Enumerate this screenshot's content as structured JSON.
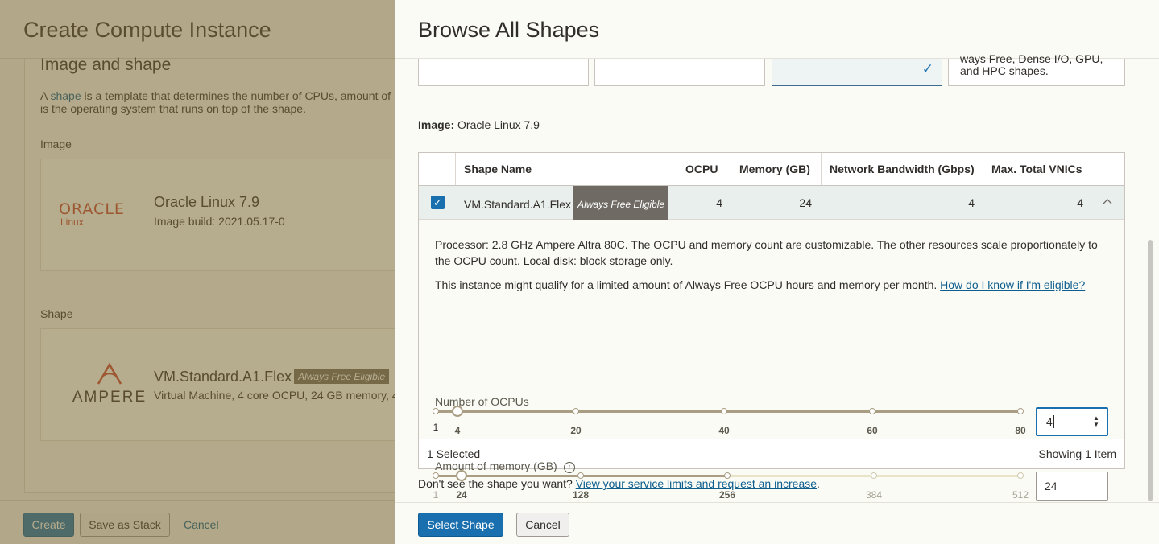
{
  "background_page": {
    "title": "Create Compute Instance",
    "section_title": "Image and shape",
    "desc_pre": "A ",
    "desc_link": "shape",
    "desc_post": " is a template that determines the number of CPUs, amount of",
    "desc_line2": "is the operating system that runs on top of the shape.",
    "image_label": "Image",
    "image_logo_top": "ORACLE",
    "image_logo_bottom": "Linux",
    "image_name": "Oracle Linux 7.9",
    "image_build": "Image build: 2021.05.17-0",
    "shape_label": "Shape",
    "shape_logo_word": "AMPERE",
    "shape_name": "VM.Standard.A1.Flex",
    "shape_badge": "Always Free Eligible",
    "shape_desc": "Virtual Machine, 4 core OCPU, 24 GB memory, 4",
    "footer": {
      "create": "Create",
      "save_as_stack": "Save as Stack",
      "cancel": "Cancel"
    }
  },
  "drawer": {
    "title": "Browse All Shapes",
    "series_cards": [
      {
        "text": ""
      },
      {
        "text": ""
      },
      {
        "text": "",
        "selected": true
      },
      {
        "text_line1": "ways Free, Dense I/O, GPU,",
        "text_line2": "and HPC shapes."
      }
    ],
    "image_label": "Image:",
    "image_value": "Oracle Linux 7.9",
    "table": {
      "columns": [
        "Shape Name",
        "OCPU",
        "Memory (GB)",
        "Network Bandwidth (Gbps)",
        "Max. Total VNICs"
      ],
      "row": {
        "selected": true,
        "shape_name": "VM.Standard.A1.Flex",
        "badge": "Always Free Eligible",
        "ocpu": "4",
        "memory": "24",
        "network_bandwidth": "4",
        "max_vnics": "4"
      },
      "details": {
        "processor_line1": "Processor: 2.8 GHz Ampere Altra 80C. The OCPU and memory count are customizable. The other resources scale proportionately to",
        "processor_line2": "the OCPU count. Local disk: block storage only.",
        "free_text": "This instance might qualify for a limited amount of Always Free OCPU hours and memory per month. ",
        "free_link": "How do I know if I'm eligible?",
        "ocpu_slider": {
          "label": "Number of OCPUs",
          "min": 1,
          "max": 80,
          "value": 4,
          "ticks": [
            "1",
            "4",
            "20",
            "40",
            "60",
            "80"
          ],
          "input_value": "4"
        },
        "memory_slider": {
          "label": "Amount of memory (GB)",
          "min": 1,
          "max": 512,
          "value": 24,
          "enabled_max": 256,
          "ticks": [
            "1",
            "24",
            "128",
            "256",
            "384",
            "512"
          ],
          "input_value": "24"
        }
      },
      "footer_left": "1 Selected",
      "footer_right": "Showing 1 Item"
    },
    "limits_text": "Don't see the shape you want? ",
    "limits_link": "View your service limits and request an increase",
    "limits_end": ".",
    "footer": {
      "select_shape": "Select Shape",
      "cancel": "Cancel"
    }
  },
  "colors": {
    "primary": "#1a6fae",
    "link": "#0d5e8f",
    "badge_bg": "#6f6b64",
    "oracle_red": "#c74634"
  }
}
